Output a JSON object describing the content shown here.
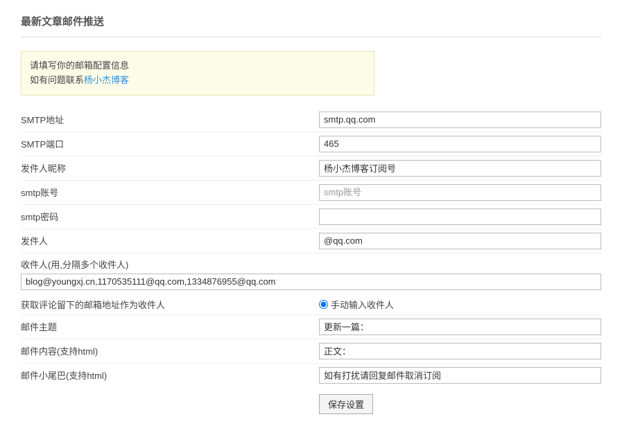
{
  "title": "最新文章邮件推送",
  "notice": {
    "line1": "请填写你的邮箱配置信息",
    "line2_prefix": "如有问题联系",
    "line2_link": "杨小杰博客"
  },
  "labels": {
    "smtp_host": "SMTP地址",
    "smtp_port": "SMTP端口",
    "sender_nick": "发件人昵称",
    "smtp_user": "smtp账号",
    "smtp_pass": "smtp密码",
    "sender": "发件人",
    "recipients": "收件人(用,分隔多个收件人)",
    "recipient_mode": "获取评论留下的邮箱地址作为收件人",
    "subject": "邮件主题",
    "body": "邮件内容(支持html)",
    "footer": "邮件小尾巴(支持html)"
  },
  "values": {
    "smtp_host": "smtp.qq.com",
    "smtp_port": "465",
    "sender_nick": "杨小杰博客订阅号",
    "smtp_user": "",
    "smtp_user_placeholder": "smtp账号",
    "smtp_pass": "",
    "sender": "@qq.com",
    "recipients": "blog@youngxj.cn,1170535111@qq.com,1334876955@qq.com",
    "recipient_mode_manual": "手动输入收件人",
    "subject": "更新一篇：",
    "body": "正文：",
    "footer": "如有打扰请回复邮件取消订阅"
  },
  "buttons": {
    "save": "保存设置"
  }
}
